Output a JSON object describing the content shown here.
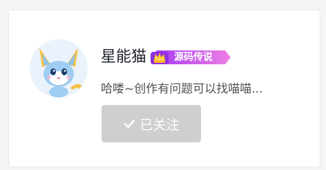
{
  "profile": {
    "username": "星能猫",
    "badge_label": "源码传说",
    "bio": "哈喽~创作有问题可以找喵喵...",
    "follow_button_label": "已关注",
    "avatar_icon": "cartoon-cat-avatar",
    "badge_icon": "crown-icon",
    "follow_icon": "check-icon"
  },
  "colors": {
    "badge_start": "#a63cf0",
    "badge_end": "#ee7fe6",
    "button_bg": "#cfcfcf",
    "avatar_bg": "#eaf3fb"
  }
}
